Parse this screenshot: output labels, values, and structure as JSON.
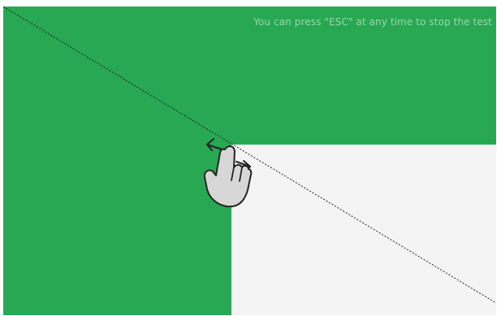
{
  "screen": {
    "background_color": "#28a853",
    "revealed_color": "#f4f4f4",
    "line_color": "#1c1c1c"
  },
  "hint": {
    "text": "You can press \"ESC\" at any time to stop the test",
    "color": "#a5d9b3"
  },
  "gesture": {
    "icon": "hand-swipe-icon",
    "hand_fill": "#d7d7d7",
    "hand_stroke": "#232323"
  }
}
